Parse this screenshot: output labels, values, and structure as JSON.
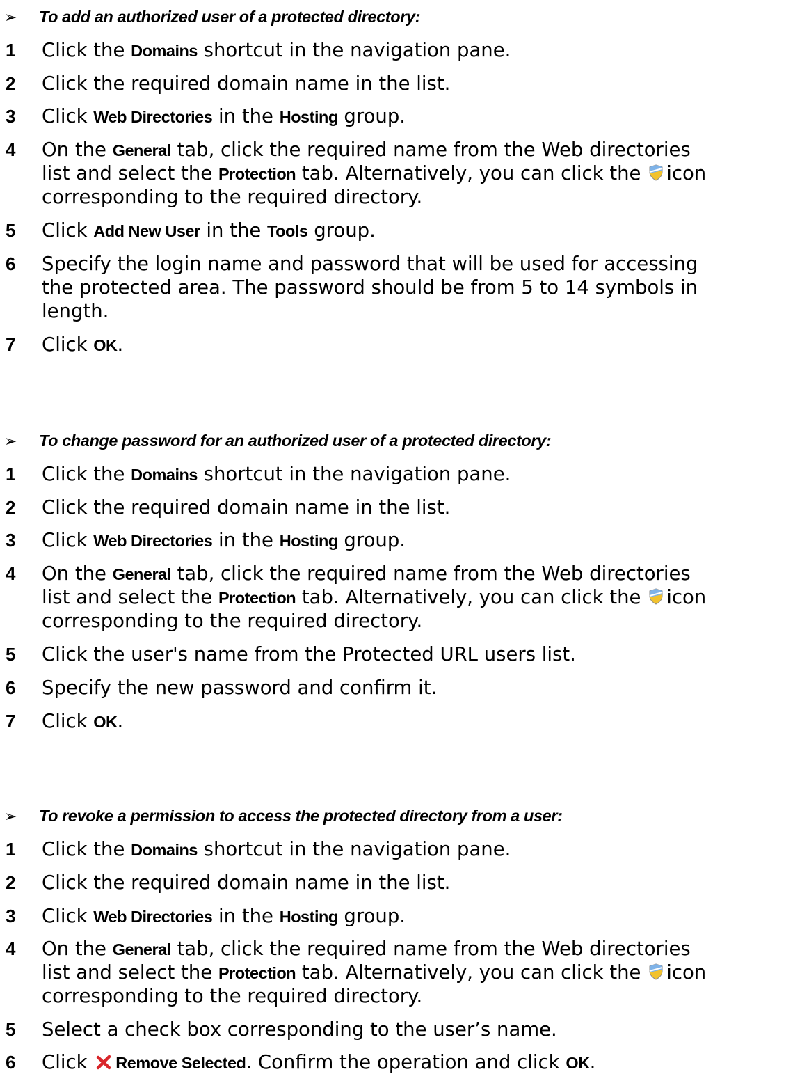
{
  "sections": [
    {
      "title": "To add an authorized user of a protected directory:",
      "steps": [
        {
          "num": "1",
          "parts": [
            "Click the ",
            "Domains",
            " shortcut in the navigation pane."
          ]
        },
        {
          "num": "2",
          "parts": [
            "Click the required domain name in the list."
          ]
        },
        {
          "num": "3",
          "parts": [
            "Click ",
            "Web Directories",
            " in the ",
            "Hosting",
            " group."
          ]
        },
        {
          "num": "4",
          "line1": [
            "On the ",
            "General",
            " tab, click the required name from the Web directories"
          ],
          "line2": [
            "list and select the ",
            "Protection",
            " tab. Alternatively, you can click the ",
            "icon"
          ],
          "line3": [
            "corresponding to the required directory."
          ]
        },
        {
          "num": "5",
          "parts": [
            "Click ",
            "Add New User",
            " in the ",
            "Tools",
            " group."
          ]
        },
        {
          "num": "6",
          "line1": [
            "Specify the login name and password that will be used for accessing"
          ],
          "line2": [
            "the protected area. The password should be from 5 to 14 symbols in"
          ],
          "line3": [
            "length."
          ]
        },
        {
          "num": "7",
          "parts": [
            "Click ",
            "OK",
            "."
          ]
        }
      ]
    },
    {
      "title": "To change password for an authorized user of a protected directory:",
      "steps": [
        {
          "num": "1",
          "parts": [
            "Click the ",
            "Domains",
            " shortcut in the navigation pane."
          ]
        },
        {
          "num": "2",
          "parts": [
            "Click the required domain name in the list."
          ]
        },
        {
          "num": "3",
          "parts": [
            "Click ",
            "Web Directories",
            " in the ",
            "Hosting",
            " group."
          ]
        },
        {
          "num": "4",
          "line1": [
            "On the ",
            "General",
            " tab, click the required name from the Web directories"
          ],
          "line2": [
            "list and select the ",
            "Protection",
            " tab. Alternatively, you can click the ",
            "icon"
          ],
          "line3": [
            "corresponding to the required directory."
          ]
        },
        {
          "num": "5",
          "parts": [
            "Click the user's name from the Protected URL users list."
          ]
        },
        {
          "num": "6",
          "parts": [
            "Specify the new password and confirm it."
          ]
        },
        {
          "num": "7",
          "parts": [
            "Click ",
            "OK",
            "."
          ]
        }
      ]
    },
    {
      "title": "To revoke a permission to access the protected directory from a user:",
      "steps": [
        {
          "num": "1",
          "parts": [
            "Click the ",
            "Domains",
            " shortcut in the navigation pane."
          ]
        },
        {
          "num": "2",
          "parts": [
            "Click the required domain name in the list."
          ]
        },
        {
          "num": "3",
          "parts": [
            "Click ",
            "Web Directories",
            " in the ",
            "Hosting",
            " group."
          ]
        },
        {
          "num": "4",
          "line1": [
            "On the ",
            "General",
            " tab, click the required name from the Web directories"
          ],
          "line2": [
            "list and select the ",
            "Protection",
            " tab. Alternatively, you can click the ",
            "icon"
          ],
          "line3": [
            "corresponding to the required directory."
          ]
        },
        {
          "num": "5",
          "parts": [
            "Select a check box corresponding to the user’s name."
          ]
        },
        {
          "num": "6",
          "parts": [
            "Click ",
            "Remove Selected",
            ". Confirm the operation and click ",
            "OK",
            "."
          ]
        }
      ]
    }
  ],
  "icons": {
    "protection": "shield-icon",
    "remove": "remove-x-icon",
    "procedure_marker": "arrow-bullet-icon"
  },
  "colors": {
    "shield_top": "#7fb3e8",
    "shield_bottom": "#f2c22e",
    "remove_x": "#d9262b"
  }
}
